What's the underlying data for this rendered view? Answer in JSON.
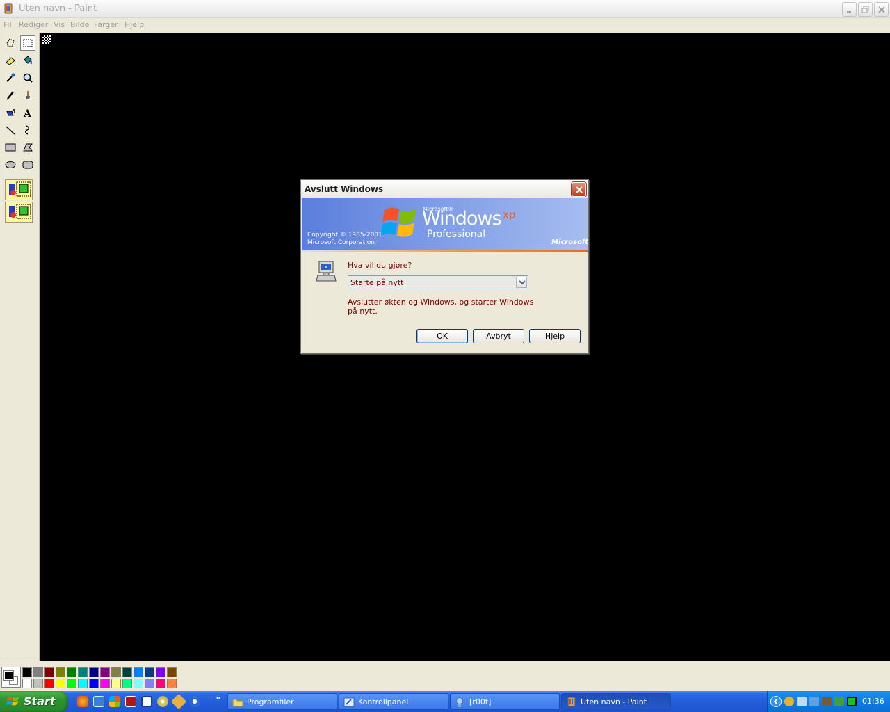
{
  "window": {
    "title": "Uten navn - Paint"
  },
  "menu": [
    "Fil",
    "Rediger",
    "Vis",
    "Bilde",
    "Farger",
    "Hjelp"
  ],
  "palette": {
    "foreground": "#000000",
    "background": "#ffffff",
    "top_row": [
      "#000000",
      "#808080",
      "#800000",
      "#808000",
      "#008000",
      "#008080",
      "#000080",
      "#800080",
      "#808040",
      "#004040",
      "#0080ff",
      "#004080",
      "#8000ff",
      "#804000"
    ],
    "bottom_row": [
      "#ffffff",
      "#c0c0c0",
      "#ff0000",
      "#ffff00",
      "#00ff00",
      "#00ffff",
      "#0000ff",
      "#ff00ff",
      "#ffff80",
      "#00ff80",
      "#80ffff",
      "#8080ff",
      "#ff0080",
      "#ff8040"
    ]
  },
  "dialog": {
    "title": "Avslutt Windows",
    "banner": {
      "microsoft_small": "Microsoft®",
      "windows": "Windows",
      "xp": "xp",
      "edition": "Professional",
      "copyright_line1": "Copyright © 1985-2001",
      "copyright_line2": "Microsoft Corporation",
      "brand": "Microsoft"
    },
    "question": "Hva vil du gjøre?",
    "selected_action": "Starte på nytt",
    "description": "Avslutter økten og Windows, og starter Windows på nytt.",
    "buttons": {
      "ok": "OK",
      "cancel": "Avbryt",
      "help": "Hjelp"
    }
  },
  "taskbar": {
    "start_label": "Start",
    "quick_launch_more": "»",
    "tasks": [
      {
        "label": "Programfiler",
        "icon": "folder-icon"
      },
      {
        "label": "Kontrollpanel",
        "icon": "control-panel-icon"
      },
      {
        "label": "[r00t]",
        "icon": "chat-icon"
      },
      {
        "label": "Uten navn - Paint",
        "icon": "paint-icon"
      }
    ],
    "clock": "01:36"
  }
}
